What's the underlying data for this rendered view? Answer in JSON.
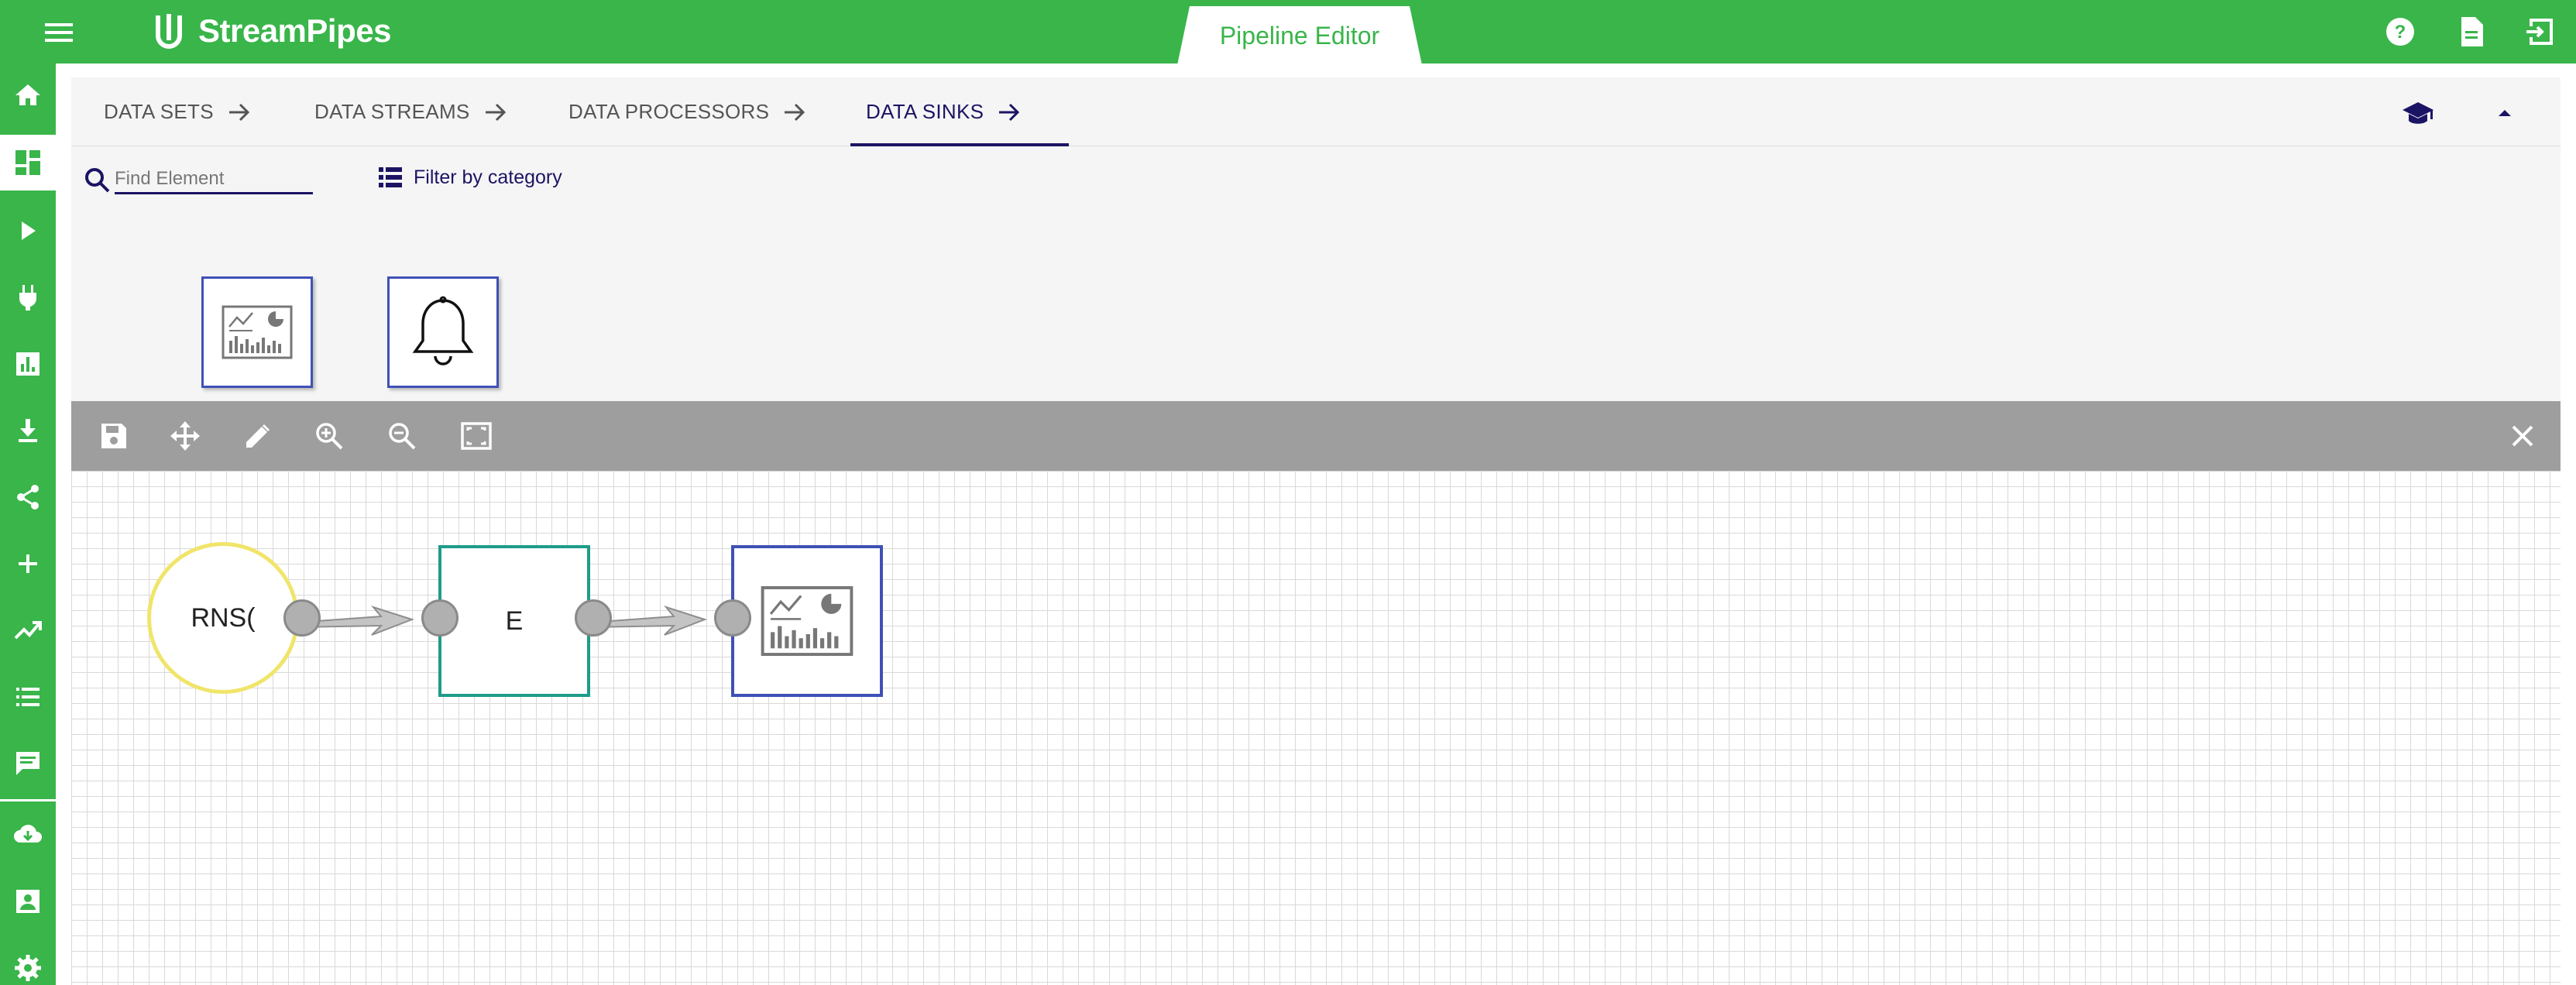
{
  "app": {
    "name": "StreamPipes",
    "active_view": "Pipeline Editor"
  },
  "colors": {
    "brand_green": "#39b54a",
    "accent_navy": "#1b1464",
    "sink_border": "#3f51b5",
    "processor_border": "#1e9c8a",
    "stream_border": "#f0e56b"
  },
  "topbar": {
    "icons": [
      "menu-icon",
      "help-icon",
      "document-icon",
      "logout-icon"
    ]
  },
  "sidenav": {
    "items": [
      "home",
      "pipeline-editor",
      "pipelines",
      "connect",
      "dashboard",
      "install",
      "share",
      "add",
      "trending",
      "list",
      "notifications",
      "cloud-download",
      "account",
      "settings"
    ]
  },
  "tabs": [
    {
      "label": "DATA SETS"
    },
    {
      "label": "DATA STREAMS"
    },
    {
      "label": "DATA PROCESSORS"
    },
    {
      "label": "DATA SINKS",
      "active": true
    }
  ],
  "palette": {
    "search_placeholder": "Find Element",
    "filter_label": "Filter by category",
    "items": [
      "dashboard-sink",
      "notification-sink"
    ]
  },
  "toolbar": {
    "tools": [
      "save",
      "move",
      "edit",
      "zoom-in",
      "zoom-out",
      "fit-to-screen",
      "close"
    ]
  },
  "pipeline": {
    "nodes": [
      {
        "type": "stream",
        "label": "RNS("
      },
      {
        "type": "processor",
        "label": "E"
      },
      {
        "type": "sink",
        "icon": "dashboard-icon"
      }
    ]
  }
}
